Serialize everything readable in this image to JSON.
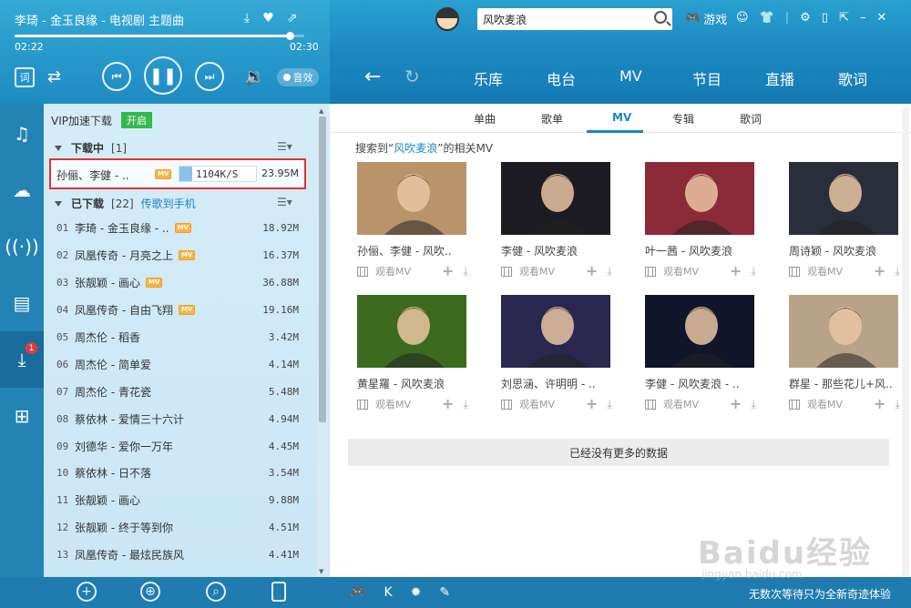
{
  "player": {
    "now_playing": "李琦 - 金玉良缘 - 电视剧 主题曲",
    "current_time": "02:22",
    "total_time": "02:30",
    "progress_fraction": 0.95,
    "icons": [
      "download-icon",
      "heart-icon",
      "share-icon"
    ],
    "lyric_label": "词",
    "effect_label": "音效"
  },
  "header": {
    "search_value": "风吹麦浪",
    "game_label": "游戏",
    "nav": [
      "乐库",
      "电台",
      "MV",
      "节目",
      "直播",
      "歌词"
    ]
  },
  "sidebar": {
    "icons": [
      "music-note-icon",
      "cloud-icon",
      "radio-icon",
      "video-icon",
      "download-icon",
      "apps-icon"
    ],
    "download_badge": "1"
  },
  "download_panel": {
    "vip_label": "VIP加速下载",
    "vip_toggle": "开启",
    "downloading": {
      "title": "下载中",
      "count": "[1]",
      "item": {
        "name": "孙俪、李健 - ..",
        "mv": "MV",
        "speed": "1104K/S",
        "size": "23.95M"
      }
    },
    "downloaded": {
      "title": "已下载",
      "count": "[22]",
      "to_phone": "传歌到手机",
      "items": [
        {
          "num": "01",
          "name": "李琦 - 金玉良缘 - ..",
          "mv": "MV",
          "size": "18.92M"
        },
        {
          "num": "02",
          "name": "凤凰传奇 - 月亮之上",
          "mv": "MV",
          "size": "16.37M"
        },
        {
          "num": "03",
          "name": "张靓颖 - 画心",
          "mv": "MV",
          "size": "36.88M"
        },
        {
          "num": "04",
          "name": "凤凰传奇 - 自由飞翔",
          "mv": "MV",
          "size": "19.16M"
        },
        {
          "num": "05",
          "name": "周杰伦 - 稻香",
          "mv": "",
          "size": "3.42M"
        },
        {
          "num": "06",
          "name": "周杰伦 - 简单爱",
          "mv": "",
          "size": "4.14M"
        },
        {
          "num": "07",
          "name": "周杰伦 - 青花瓷",
          "mv": "",
          "size": "5.48M"
        },
        {
          "num": "08",
          "name": "蔡依林 - 爱情三十六计",
          "mv": "",
          "size": "4.94M"
        },
        {
          "num": "09",
          "name": "刘德华 - 爱你一万年",
          "mv": "",
          "size": "4.45M"
        },
        {
          "num": "10",
          "name": "蔡依林 - 日不落",
          "mv": "",
          "size": "3.54M"
        },
        {
          "num": "11",
          "name": "张靓颖 - 画心",
          "mv": "",
          "size": "9.88M"
        },
        {
          "num": "12",
          "name": "张靓颖 - 终于等到你",
          "mv": "",
          "size": "4.51M"
        },
        {
          "num": "13",
          "name": "凤凰传奇 - 最炫民族风",
          "mv": "",
          "size": "4.41M"
        }
      ]
    }
  },
  "content": {
    "tabs": [
      "单曲",
      "歌单",
      "MV",
      "专辑",
      "歌词"
    ],
    "active_tab": "MV",
    "result_prefix": "搜索到“",
    "result_keyword": "风吹麦浪",
    "result_suffix": "”的相关MV",
    "watch_label": "观看MV",
    "cards": [
      {
        "title": "孙俪、李健 - 风吹..",
        "bg": "#b9946a"
      },
      {
        "title": "李健 - 风吹麦浪",
        "bg": "#1c1c22"
      },
      {
        "title": "叶一茜 - 风吹麦浪",
        "bg": "#8c2a3a"
      },
      {
        "title": "周诗颖 - 风吹麦浪",
        "bg": "#2a2e3a"
      },
      {
        "title": "黄星羅 - 风吹麦浪",
        "bg": "#3c6a1e"
      },
      {
        "title": "刘思涵、许明明 - ..",
        "bg": "#2a2850"
      },
      {
        "title": "李健 - 风吹麦浪 - ..",
        "bg": "#12162a"
      },
      {
        "title": "群星 - 那些花儿+风..",
        "bg": "#b8a288"
      }
    ],
    "no_more": "已经没有更多的数据"
  },
  "status_bar": {
    "text": "无数次等待只为全新奇迹体验"
  },
  "watermark": {
    "logo": "Baidu经验",
    "url": "jingyan.baidu.com"
  }
}
